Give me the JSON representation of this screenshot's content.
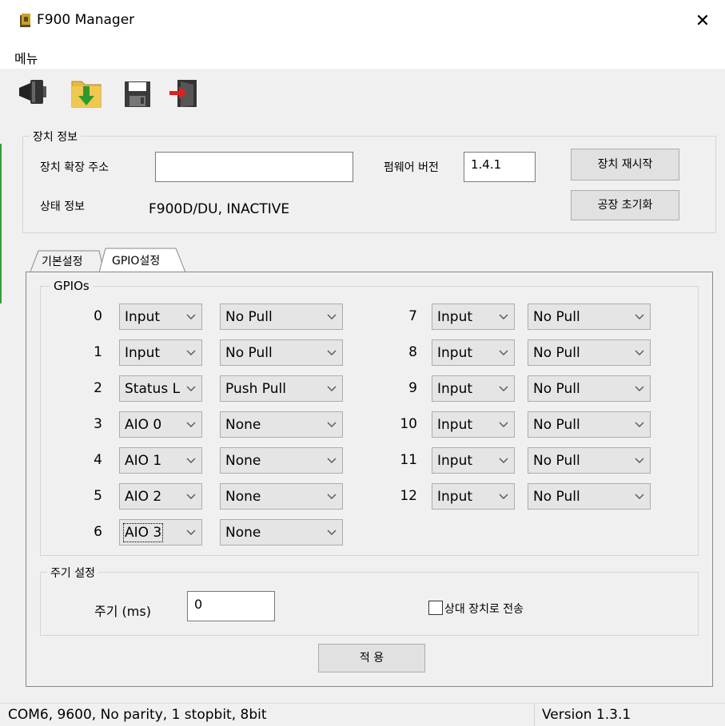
{
  "window": {
    "title": "F900 Manager",
    "close_glyph": "✕"
  },
  "menu": {
    "label": "메뉴"
  },
  "toolbar": [
    {
      "icon": "speaker-icon"
    },
    {
      "icon": "folder-download-icon"
    },
    {
      "icon": "save-icon"
    },
    {
      "icon": "exit-door-icon"
    }
  ],
  "device_info": {
    "group_title": "장치 정보",
    "ext_address_label": "장치 확장 주소",
    "ext_address_value": "",
    "firmware_label": "펌웨어 버전",
    "firmware_value": "1.4.1",
    "status_label": "상태 정보",
    "status_value": "F900D/DU, INACTIVE",
    "restart_button": "장치 재시작",
    "factory_reset_button": "공장 초기화"
  },
  "tabs": [
    {
      "label": "기본설정",
      "active": false
    },
    {
      "label": "GPIO설정",
      "active": true
    }
  ],
  "gpios": {
    "group_title": "GPIOs",
    "left": [
      {
        "num": "0",
        "mode": "Input",
        "pull": "No Pull"
      },
      {
        "num": "1",
        "mode": "Input",
        "pull": "No Pull"
      },
      {
        "num": "2",
        "mode": "Status L",
        "pull": "Push Pull"
      },
      {
        "num": "3",
        "mode": "AIO 0",
        "pull": "None"
      },
      {
        "num": "4",
        "mode": "AIO 1",
        "pull": "None"
      },
      {
        "num": "5",
        "mode": "AIO 2",
        "pull": "None"
      },
      {
        "num": "6",
        "mode": "AIO 3",
        "pull": "None"
      }
    ],
    "right": [
      {
        "num": "7",
        "mode": "Input",
        "pull": "No Pull"
      },
      {
        "num": "8",
        "mode": "Input",
        "pull": "No Pull"
      },
      {
        "num": "9",
        "mode": "Input",
        "pull": "No Pull"
      },
      {
        "num": "10",
        "mode": "Input",
        "pull": "No Pull"
      },
      {
        "num": "11",
        "mode": "Input",
        "pull": "No Pull"
      },
      {
        "num": "12",
        "mode": "Input",
        "pull": "No Pull"
      }
    ]
  },
  "period": {
    "group_title": "주기 설정",
    "label": "주기 (ms)",
    "value": "0",
    "checkbox_label": "상대 장치로 전송",
    "checked": false
  },
  "apply_button": "적 용",
  "status_bar": {
    "connection": "COM6, 9600, No parity, 1 stopbit, 8bit",
    "version": "Version 1.3.1"
  }
}
